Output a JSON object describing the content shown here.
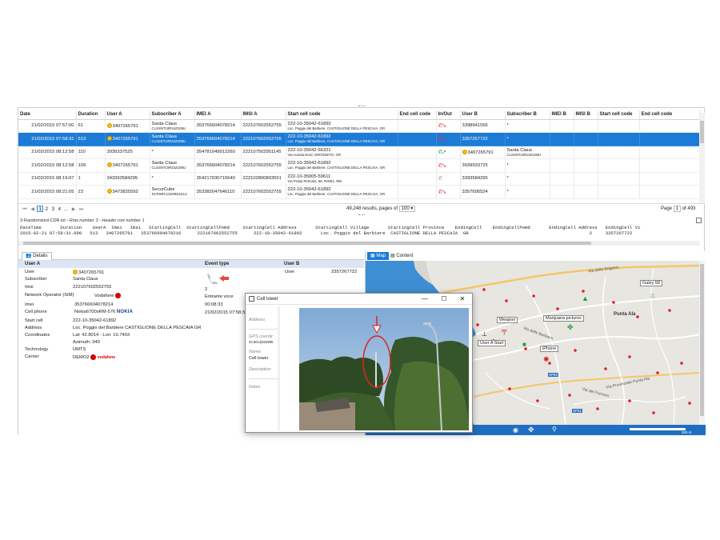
{
  "grid": {
    "columns": [
      "Date",
      "Duration",
      "User A",
      "Subscriber A",
      "IMEI A",
      "IMSI A",
      "Start cell code",
      "End cell code",
      "In/Out",
      "User B",
      "Subscriber B",
      "IMEI B",
      "IMSI B",
      "Start cell code",
      "End cell code"
    ],
    "rows": [
      {
        "date": "21/02/2015 07:57:00",
        "duration": "61",
        "user_a": "3407265791",
        "sub_a": "Santa Claus",
        "sub_a2": "CLSSNT10R24Z109U",
        "imei_a": "353766604078214",
        "imsi_a": "222107602552755",
        "cell": "222-10-35042-61892",
        "cell2": "Loc. Poggio del Barbiere, CASTIGLIONE DELLA PESCAIA, GR",
        "user_b": "3398941556",
        "sub_b": "*",
        "sub_b2": "",
        "dir": "in"
      },
      {
        "date": "21/02/2015 07:58:31",
        "duration": "513",
        "user_a": "3407265791",
        "sub_a": "Santa Claus",
        "sub_a2": "CLSSNT10R24Z109U",
        "imei_a": "353766604078214",
        "imsi_a": "222107602552755",
        "cell": "222-10-35042-61892",
        "cell2": "Loc. Poggio del Barbiere, CASTIGLIONE DELLA PESCAIA, GR",
        "user_b": "3357267722",
        "sub_b": "*",
        "sub_b2": "",
        "dir": "in"
      },
      {
        "date": "21/02/2015 08:12:58",
        "duration": "110",
        "user_a": "3939337525",
        "sub_a": "*",
        "sub_a2": "",
        "imei_a": "354781049912260",
        "imsi_a": "222107502951145",
        "cell": "222-10-35042-56321",
        "cell2": "Via Aurelia Nord, GROSSETO, GR",
        "user_b": "3407265791",
        "sub_b": "Santa Claus",
        "sub_b2": "CLSSNT10R24Z109U",
        "dir": "out"
      },
      {
        "date": "21/02/2015 08:12:58",
        "duration": "109",
        "user_a": "3407265791",
        "sub_a": "Santa Claus",
        "sub_a2": "CLSSNT10R24Z109U",
        "imei_a": "353766604078214",
        "imsi_a": "222107602552755",
        "cell": "222-10-35042-61892",
        "cell2": "Loc. Poggio del Barbiere, CASTIGLIONE DELLA PESCAIA, GR",
        "user_b": "3939933725",
        "sub_b": "*",
        "sub_b2": "",
        "dir": "in"
      },
      {
        "date": "21/02/2015 08:19:07",
        "duration": "1",
        "user_a": "343393584295",
        "sub_a": "*",
        "sub_a2": "",
        "imei_a": "354217030715640",
        "imsi_a": "222102800893551",
        "cell": "222-10-35005-59611",
        "cell2": "Via Proba Petronia, 68, ROMA, RM",
        "user_b": "3393584295",
        "sub_b": "*",
        "sub_b2": "",
        "dir": "sms"
      },
      {
        "date": "21/02/2015 08:21:05",
        "duration": "23",
        "user_a": "3473825592",
        "sub_a": "SecurCube",
        "sub_a2": "SCRSRC12S09G221U",
        "imei_a": "353382047646110",
        "imsi_a": "222107602552755",
        "cell": "222-10-35042-61892",
        "cell2": "Loc. Poggio del Barbiere, CASTIGLIONE DELLA PESCAIA, GR",
        "user_b": "3357695524",
        "sub_b": "*",
        "sub_b2": "",
        "dir": "in"
      }
    ]
  },
  "pager": {
    "pages": [
      "1",
      "2",
      "3",
      "4",
      "..."
    ],
    "current": "1",
    "results_text": "49,248 results, pages of",
    "page_size": "100",
    "page_label": "Page",
    "page_value": "1",
    "of_text": "of 493"
  },
  "raw": {
    "title_file": "3-Randomized-CDR.txt",
    "title_rest": " - Row number 3 - Header row number 1",
    "header_line": "DateTime       Duration    UserA  Imei   Imsi   StartingCell  StartingCellPomd     StartingCell Address       StartingCell Village       StartingCell Province    EndingCell    EndingCellPomd       EndingCell Address   EndingCell Vi",
    "data_line": "2015-02-21 07:58:31.000   513   3407265791   353766604078216      222107602552755      222-10-35042-61892       Loc. Poggio del Barbiere  CASTIGLIONE DELLA PESCAIA  GR                                             2     3357267722"
  },
  "details": {
    "tab": "Details",
    "header_user_a": "User A",
    "header_event": "Event type",
    "header_user_b": "User B",
    "labels": [
      "User",
      "Subscriber",
      "Imsi",
      "Network Operator (SIM)",
      "Imei",
      "Cell phone",
      "Start cell",
      "Address",
      "Coordinates",
      "",
      "Technology",
      "Carrier"
    ],
    "values": [
      "3407265791",
      "Santa Claus",
      "222107602552755",
      "Vodafone",
      "353766604078214",
      "Nokia6700sRM-576",
      "222-10-35042-61892",
      "Loc. Poggio del Barbiere CASTIGLIONE DELLA PESCAIA GR",
      "Lat: 42.8014 - Lon: 10.7403",
      "Azimuth: 340",
      "UMTS",
      "DEMO2"
    ],
    "nokia": "NOKIA",
    "vodafone": "vodafone",
    "event_values": [
      "2",
      "Entrante voce",
      "00:08:33",
      "21/02/2015 07:58:3"
    ],
    "user_b_label": "User",
    "user_b_value": "3357267722"
  },
  "map": {
    "tab_map": "Map",
    "tab_content": "Content",
    "places": [
      "Galey 58",
      "Weapon",
      "Marijuana pictures",
      "Punta Ala",
      "User A Start",
      "iPhone",
      "SP60",
      "SP61",
      "Via della Dogana",
      "Via delle Barbiere",
      "Via del Fornioni",
      "Via Provinciale Punta Ala"
    ],
    "scale": "300 m"
  },
  "window": {
    "title": "Cell tower",
    "fields": [
      {
        "label": "Address",
        "value": ""
      },
      {
        "label": "GPS coordir",
        "value": "42.8014|462985"
      },
      {
        "label": "Name",
        "value": "Cell tower"
      },
      {
        "label": "Description",
        "value": ""
      },
      {
        "label": "Notes",
        "value": ""
      }
    ],
    "controls": [
      "—",
      "☐",
      "✕"
    ]
  }
}
